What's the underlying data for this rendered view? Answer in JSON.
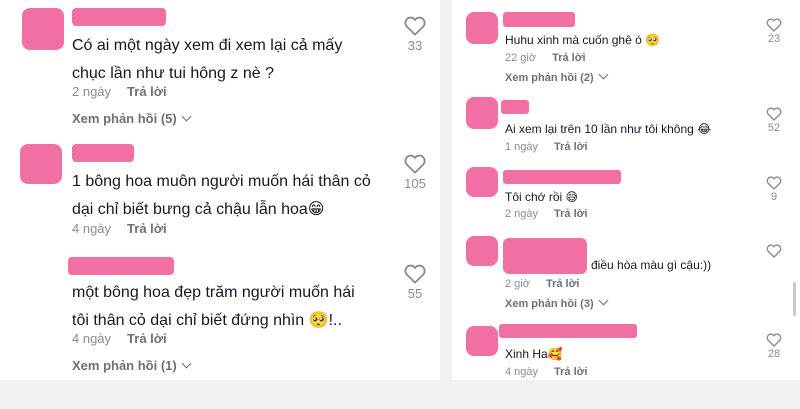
{
  "colors": {
    "placeholder": "#f26fa3",
    "text": "#161823",
    "muted": "#8a8b91",
    "panel_gap": "#f1f1f2"
  },
  "icons": {
    "like": "heart-outline-icon",
    "expand": "chevron-down-icon"
  },
  "left_comments": [
    {
      "text_lines": [
        "Có ai một ngày xem đi xem lại cả mấy",
        "chục lần như tui hông z nè ?"
      ],
      "time": "2 ngày",
      "reply": "Trả lời",
      "likes": "33",
      "view_replies": "Xem phản hồi (5)"
    },
    {
      "text_lines": [
        "1 bông hoa muôn người muốn hái thân cỏ",
        "dại chỉ biết bưng cả chậu lẫn hoa😁"
      ],
      "time": "4 ngày",
      "reply": "Trả lời",
      "likes": "105",
      "view_replies": ""
    },
    {
      "text_lines": [
        "một bông hoa đẹp trăm người muốn hái",
        "tôi thân cỏ dại chỉ biết đứng nhìn 🥺!.."
      ],
      "time": "4 ngày",
      "reply": "Trả lời",
      "likes": "55",
      "view_replies": "Xem phản hồi (1)"
    }
  ],
  "right_comments": [
    {
      "text": "Huhu xinh mà cuốn ghê ó 🥺",
      "time": "22 giờ",
      "reply": "Trả lời",
      "likes": "23",
      "view_replies": "Xem phản hồi (2)"
    },
    {
      "text": "Ai xem lại trên 10 lần như tôi không 😂",
      "time": "1 ngày",
      "reply": "Trả lời",
      "likes": "52",
      "view_replies": ""
    },
    {
      "text": "Tôi chớ rồi 😅",
      "time": "2 ngày",
      "reply": "Trả lời",
      "likes": "9",
      "view_replies": ""
    },
    {
      "text": "điều hòa màu gì cậu:))",
      "time": "2 giờ",
      "reply": "Trả lời",
      "likes": "",
      "view_replies": "Xem phản hồi (3)"
    },
    {
      "text": "Xinh Ha🥰",
      "time": "4 ngày",
      "reply": "Trả lời",
      "likes": "28",
      "view_replies": ""
    }
  ]
}
